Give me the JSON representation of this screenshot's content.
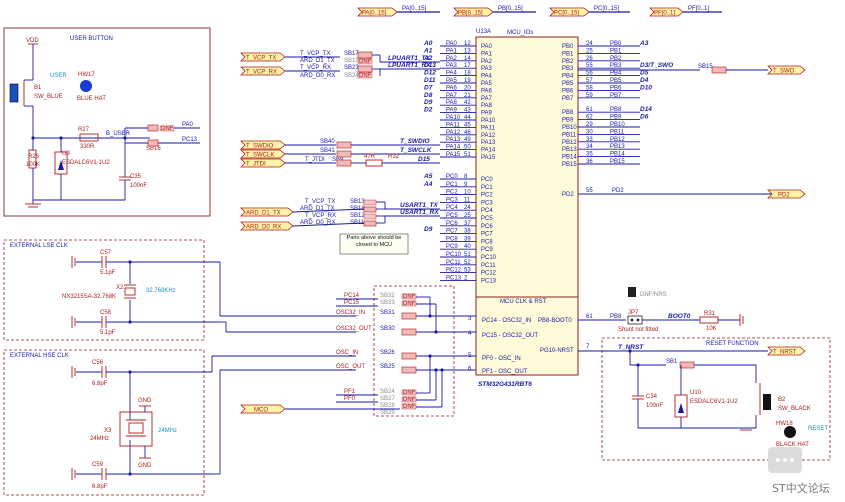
{
  "header_ports": [
    "PA[0..15]",
    "PB[0..15]",
    "PC[0..15]",
    "PF[0..1]"
  ],
  "header_nets": [
    "PA[0..15]",
    "PB[0..15]",
    "PC[0..15]",
    "PF[0..1]"
  ],
  "user_button": {
    "title": "USER BUTTON",
    "vdd": "VDD",
    "user": "USER",
    "hw": "HW17",
    "hat": "BLUE HAT",
    "b1": "B1",
    "sw": "SW_BLUE",
    "r27": "R27",
    "r27v": "330R",
    "buser": "B_USER",
    "r26": "R26",
    "r26v": "100K",
    "u9": "U9",
    "u9v": "ESDALC6V1-1U2",
    "c35": "C35",
    "c35v": "100nF",
    "sb16": "SB16",
    "dnf": "DNF",
    "pa0": "PA0",
    "pc13": "PC13"
  },
  "left_ports": {
    "t_vcp_tx": "T_VCP_TX",
    "t_vcp_rx": "T_VCP_RX",
    "t_swdio": "T_SWDIO",
    "t_swclk": "T_SWCLK",
    "t_jtdi": "T_JTDI",
    "ard_d1_tx": "ARD_D1_TX",
    "ard_d0_rx": "ARD_D0_RX",
    "mco": "MCO"
  },
  "uart_block": {
    "rows": [
      {
        "left": "T_VCP_TX",
        "sb": "SB17",
        "net": "LPUART1_TX",
        "pin": "PA2",
        "num": "12"
      },
      {
        "left": "ARD_D1_TX",
        "sb": "SB19",
        "net": "",
        "pin": "PA1",
        "num": "13"
      },
      {
        "left": "T_VCP_RX",
        "sb": "SB23",
        "net": "LPUART1_RX",
        "pin": "PA3",
        "num": "14"
      },
      {
        "left": "ARD_D0_RX",
        "sb": "SB24",
        "net": "",
        "pin": "",
        "num": ""
      }
    ],
    "dnf": "DNF"
  },
  "mcu": {
    "title": "MCU_IOs",
    "ref": "U13A",
    "clk_title": "MCU CLK & RST",
    "part": "STM32G431RBT6",
    "pa_pins": [
      "PA0",
      "PA1",
      "PA2",
      "PA3",
      "PA4",
      "PA5",
      "PA6",
      "PA7",
      "PA8",
      "PA9",
      "PA10",
      "PA11",
      "PA12",
      "PA13",
      "PA14",
      "PA15"
    ],
    "pa_nets": [
      "PA0",
      "PA1",
      "PA2",
      "PA3",
      "PA4",
      "PA5",
      "PA6",
      "PA7",
      "PA8",
      "PA9",
      "PA10",
      "PA11",
      "PA12",
      "PA13",
      "PA14",
      "PA15"
    ],
    "pa_nums": [
      "12",
      "13",
      "14",
      "17",
      "18",
      "19",
      "20",
      "21",
      "42",
      "43",
      "44",
      "45",
      "46",
      "49",
      "50",
      "51"
    ],
    "pa_arduino": [
      "A0",
      "A1",
      "A2",
      "D13",
      "D12",
      "D11",
      "D7",
      "D8",
      "D9",
      "D2",
      "",
      "",
      "",
      "",
      "",
      ""
    ],
    "pb_pins": [
      "PB0",
      "PB1",
      "PB2",
      "PB3",
      "PB4",
      "PB5",
      "PB6",
      "PB7",
      "PB8",
      "PB9",
      "PB10",
      "PB11",
      "PB12",
      "PB13",
      "PB14",
      "PB15"
    ],
    "pb_nets": [
      "PB0",
      "PB1",
      "PB2",
      "PB3",
      "PB4",
      "PB5",
      "PB6",
      "PB7",
      "PB8",
      "PB9",
      "PB10",
      "PB11",
      "PB12",
      "PB13",
      "PB14",
      "PB15"
    ],
    "pb_nums": [
      "24",
      "25",
      "26",
      "55",
      "56",
      "57",
      "58",
      "59",
      "61",
      "62",
      "29",
      "30",
      "33",
      "34",
      "35",
      "36"
    ],
    "pb_arduino": [
      "A3",
      "",
      "",
      "D3/T_SWO",
      "D5",
      "D4",
      "D10",
      "",
      "D14",
      "D6",
      "",
      "",
      "",
      "",
      "",
      ""
    ],
    "pc_pins": [
      "PC0",
      "PC1",
      "PC2",
      "PC3",
      "PC4",
      "PC5",
      "PC6",
      "PC7",
      "PC8",
      "PC9",
      "PC10",
      "PC11",
      "PC12",
      "PC13"
    ],
    "pc_nets": [
      "PC0",
      "PC1",
      "PC2",
      "PC3",
      "PC4",
      "PC5",
      "PC6",
      "PC7",
      "PC8",
      "PC9",
      "PC10",
      "PC11",
      "PC12",
      "PC13"
    ],
    "pc_nums": [
      "8",
      "9",
      "10",
      "11",
      "24",
      "25",
      "37",
      "38",
      "39",
      "40",
      "51",
      "52",
      "53",
      "2"
    ],
    "pc_arduino": [
      "A5",
      "A4",
      "",
      "",
      "",
      "",
      "",
      "",
      "",
      "",
      "",
      "",
      "",
      ""
    ],
    "pd2": "PD2",
    "pd2_num": "55",
    "clk_pins": [
      "PC14 - OSC32_IN",
      "PC15 - OSC32_OUT",
      "PF0 - OSC_IN",
      "PF1 - OSC_OUT"
    ],
    "clk_nums": [
      "3",
      "4",
      "5",
      "6"
    ],
    "boot": "PB8-BOOT0",
    "boot_num": "61",
    "nrst": "PG10-NRST",
    "nrst_num": "7"
  },
  "swd_block": {
    "sb40": "SB40",
    "sb41": "SB41",
    "jtdi": "T_JTDI",
    "sb9": "SB9",
    "r32": "R32",
    "r32v": "47R",
    "swdio": "T_SWDIO",
    "swclk": "T_SWCLK",
    "d15": "D15"
  },
  "swo": {
    "sb": "SB15",
    "port": "T_SWO",
    "pb3": "PB3"
  },
  "pd2_port": "PD2",
  "pd2_net": "PD2",
  "usart_block": {
    "rows": [
      {
        "left": "T_VCP_TX",
        "sb": "SB13"
      },
      {
        "left": "ARD_D1_TX",
        "sb": "SB18"
      },
      {
        "left": "T_VCP_RX",
        "sb": "SB12"
      },
      {
        "left": "ARD_D0_RX",
        "sb": "SB11"
      }
    ],
    "usart_tx": "USART1_TX",
    "usart_rx": "USART1_RX",
    "pc4": "PC4",
    "pc5": "PC5",
    "d9": "D9",
    "note": "Parts above should be closed to MCU"
  },
  "lse": {
    "title": "EXTERNAL LSE CLK",
    "c57": "C57",
    "c57v": "5.1pF",
    "c58": "C58",
    "c58v": "5.1pF",
    "x2": "X2",
    "x2v": "NX3215SA-32.768K",
    "freq": "32.768KHz"
  },
  "hse": {
    "title": "EXTERNAL HSE CLK",
    "c56": "C56",
    "c56v": "6.8pF",
    "c59": "C59",
    "c59v": "6.8pF",
    "x3": "X3",
    "x3v": "24MHz",
    "freq": "24MHz",
    "gnd": "GND"
  },
  "clk_bus": {
    "pc14": "PC14",
    "pc15": "PC15",
    "osc32_in": "OSC32_IN",
    "osc32_out": "OSC32_OUT",
    "osc_in": "OSC_IN",
    "osc_out": "OSC_OUT",
    "pf1": "PF1",
    "pf0": "PF0",
    "sb31": "SB31",
    "sb30": "SB30",
    "sb26": "SB26",
    "sb25": "SB25",
    "sb32": "SB32",
    "sb33": "SB33",
    "sb24": "SB24",
    "sb27": "SB27",
    "sb28": "SB28",
    "sb29": "SB29",
    "dnf": "DNF"
  },
  "boot": {
    "jp7": "JP7",
    "jp7v": "Shunt not fitted",
    "boot0": "BOOT0",
    "r31": "R31",
    "r31v": "10K",
    "pb8": "PB8",
    "dnf_note": "DNF/NRS"
  },
  "reset": {
    "title": "RESET FUNCTION",
    "tnrst": "T_NRST",
    "port": "T_NRST",
    "sb1": "SB1",
    "c34": "C34",
    "c34v": "100nF",
    "u10": "U10",
    "u10v": "ESDALC6V1-1U2",
    "b2": "B2",
    "b2v": "SW_BLACK",
    "hw": "HW18",
    "hat": "BLACK HAT",
    "reset": "RESET"
  },
  "watermark": "ST中文论坛"
}
